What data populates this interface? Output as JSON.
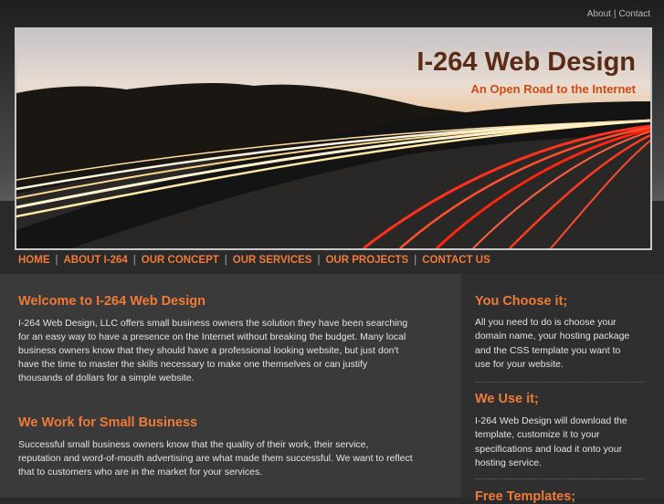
{
  "top_links": {
    "about": "About",
    "separator": "|",
    "contact": "Contact"
  },
  "header": {
    "title": "I-264 Web Design",
    "tagline": "An Open Road to the Internet"
  },
  "nav": {
    "separator": "|",
    "items": [
      {
        "label": "HOME"
      },
      {
        "label": "ABOUT I-264"
      },
      {
        "label": "OUR CONCEPT"
      },
      {
        "label": "OUR SERVICES"
      },
      {
        "label": "OUR PROJECTS"
      },
      {
        "label": "CONTACT US"
      }
    ]
  },
  "main": {
    "welcome_heading": "Welcome to I-264 Web Design",
    "welcome_lines": [
      "I-264 Web Design, LLC offers small business owners the solution they have been searching",
      "for an easy way to have a presence on the Internet without breaking the budget. Many local",
      "business owners know that they should have a professional looking website, but just don't",
      "have the time to master the skills necessary to make one themselves or can justify",
      "thousands of dollars for a simple website."
    ],
    "work_heading": "We Work for Small Business",
    "work_lines": [
      "Successful small business owners know that the quality of their work, their service,",
      "reputation and word-of-mouth advertising are what made them successful. We want to reflect",
      "that to customers who are in the market for your services."
    ]
  },
  "sidebar": {
    "choose_heading": "You Choose it;",
    "choose_lines": [
      "All you need to do is choose your",
      "domain name, your hosting package",
      "and the CSS template you want to",
      "use for your website."
    ],
    "use_heading": "We Use it;",
    "use_lines": [
      "I-264 Web Design will download the",
      "template, customize it to your",
      "specifications and load it onto your",
      "hosting service."
    ],
    "free_heading": "Free Templates;"
  },
  "colors": {
    "accent": "#f07a38",
    "title": "#5a2a14",
    "tagline": "#d04a14"
  }
}
